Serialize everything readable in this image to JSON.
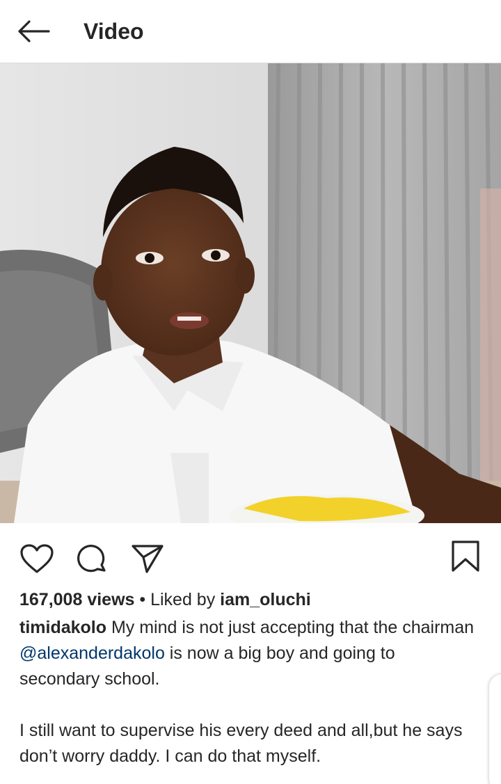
{
  "header": {
    "title": "Video",
    "back_icon": "arrow-left-icon"
  },
  "video": {
    "description_icon": "video-player"
  },
  "actions": {
    "like_icon": "heart-icon",
    "comment_icon": "comment-icon",
    "share_icon": "paper-plane-icon",
    "save_icon": "bookmark-icon"
  },
  "stats": {
    "views": "167,008 views",
    "separator": " • ",
    "liked_by_prefix": "Liked by ",
    "liked_by_user": "iam_oluchi"
  },
  "caption": {
    "username": "timidakolo",
    "text_part1": " My mind is not just accepting that the chairman ",
    "mention": "@alexanderdakolo",
    "text_part2": " is now a big boy and going to secondary school.",
    "paragraph2": "I still want to supervise his every deed and all,but he says don’t worry daddy. I can do that myself."
  },
  "colors": {
    "text": "#262626",
    "mention": "#00376b",
    "divider": "#dbdbdb"
  }
}
